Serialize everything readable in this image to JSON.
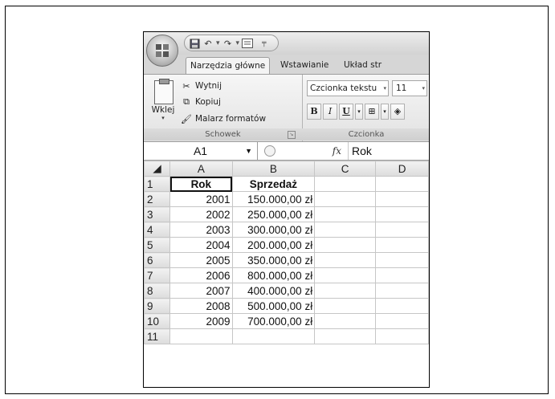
{
  "quick_access": {
    "save_icon": "save-icon",
    "undo_icon": "undo-icon",
    "redo_icon": "redo-icon",
    "custom_icon": "form-icon"
  },
  "tabs": [
    {
      "label": "Narzędzia główne",
      "active": true
    },
    {
      "label": "Wstawianie",
      "active": false
    },
    {
      "label": "Układ str",
      "active": false
    }
  ],
  "clipboard": {
    "paste_label": "Wklej",
    "cut_label": "Wytnij",
    "copy_label": "Kopiuj",
    "painter_label": "Malarz formatów",
    "group_label": "Schowek"
  },
  "font": {
    "font_name": "Czcionka tekstu",
    "font_size": "11",
    "bold": "B",
    "italic": "I",
    "underline": "U",
    "group_label": "Czcionka"
  },
  "formula_bar": {
    "name_box": "A1",
    "fx_label": "fx",
    "value": "Rok"
  },
  "sheet": {
    "columns": [
      "A",
      "B",
      "C",
      "D"
    ],
    "row_numbers": [
      "1",
      "2",
      "3",
      "4",
      "5",
      "6",
      "7",
      "8",
      "9",
      "10",
      "11"
    ],
    "header": {
      "A": "Rok",
      "B": "Sprzedaż"
    },
    "rows": [
      {
        "year": "2001",
        "sales": "150.000,00 zł"
      },
      {
        "year": "2002",
        "sales": "250.000,00 zł"
      },
      {
        "year": "2003",
        "sales": "300.000,00 zł"
      },
      {
        "year": "2004",
        "sales": "200.000,00 zł"
      },
      {
        "year": "2005",
        "sales": "350.000,00 zł"
      },
      {
        "year": "2006",
        "sales": "800.000,00 zł"
      },
      {
        "year": "2007",
        "sales": "400.000,00 zł"
      },
      {
        "year": "2008",
        "sales": "500.000,00 zł"
      },
      {
        "year": "2009",
        "sales": "700.000,00 zł"
      }
    ]
  }
}
